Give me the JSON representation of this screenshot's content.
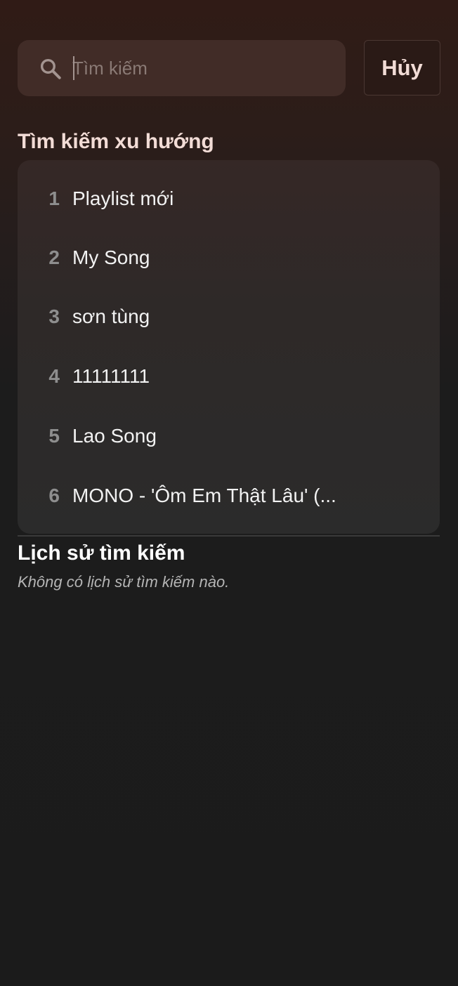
{
  "search": {
    "placeholder": "Tìm kiếm",
    "value": "",
    "cancel_label": "Hủy"
  },
  "trending": {
    "title": "Tìm kiếm xu hướng",
    "items": [
      {
        "rank": "1",
        "label": "Playlist mới"
      },
      {
        "rank": "2",
        "label": "My Song"
      },
      {
        "rank": "3",
        "label": "sơn tùng"
      },
      {
        "rank": "4",
        "label": "11111111"
      },
      {
        "rank": "5",
        "label": "Lao Song"
      },
      {
        "rank": "6",
        "label": "MONO - 'Ôm Em Thật Lâu' (..."
      }
    ]
  },
  "history": {
    "title": "Lịch sử tìm kiếm",
    "empty_text": "Không có lịch sử tìm kiếm nào."
  },
  "icons": {
    "search": "search-icon"
  }
}
